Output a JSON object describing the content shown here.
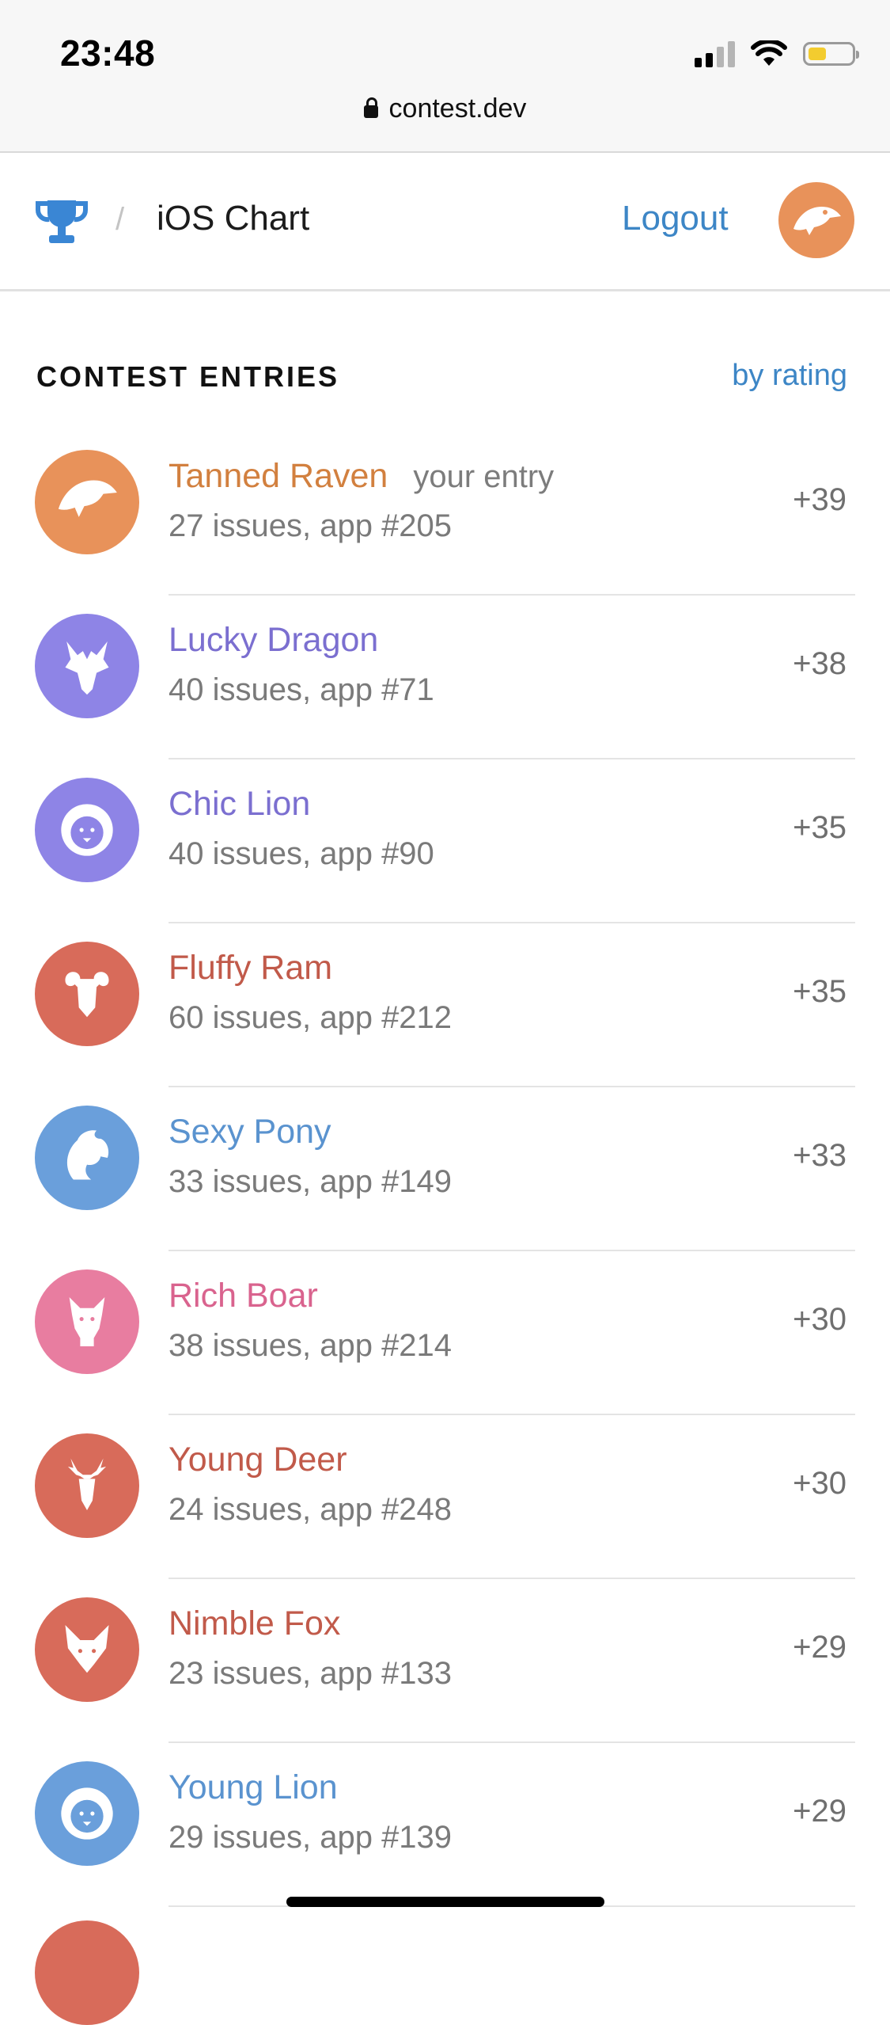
{
  "status_bar": {
    "time": "23:48"
  },
  "browser": {
    "url": "contest.dev"
  },
  "header": {
    "separator": "/",
    "title": "iOS Chart",
    "logout_label": "Logout"
  },
  "section": {
    "title": "CONTEST ENTRIES",
    "sort_label": "by rating"
  },
  "entries": [
    {
      "name": "Tanned Raven",
      "tag": "your entry",
      "meta": "27 issues, app #205",
      "score": "+39",
      "color": "#d2803f",
      "avatar_color": "#e8925a",
      "icon": "raven-icon"
    },
    {
      "name": "Lucky Dragon",
      "tag": "",
      "meta": "40 issues, app #71",
      "score": "+38",
      "color": "#7b6fd0",
      "avatar_color": "#8e84e6",
      "icon": "dragon-icon"
    },
    {
      "name": "Chic Lion",
      "tag": "",
      "meta": "40 issues, app #90",
      "score": "+35",
      "color": "#7b6fd0",
      "avatar_color": "#8e84e6",
      "icon": "lion-icon"
    },
    {
      "name": "Fluffy Ram",
      "tag": "",
      "meta": "60 issues, app #212",
      "score": "+35",
      "color": "#c15a4a",
      "avatar_color": "#d86b5a",
      "icon": "ram-icon"
    },
    {
      "name": "Sexy Pony",
      "tag": "",
      "meta": "33 issues, app #149",
      "score": "+33",
      "color": "#5a93cf",
      "avatar_color": "#6a9fdb",
      "icon": "pony-icon"
    },
    {
      "name": "Rich Boar",
      "tag": "",
      "meta": "38 issues, app #214",
      "score": "+30",
      "color": "#d9638e",
      "avatar_color": "#e87da0",
      "icon": "boar-icon"
    },
    {
      "name": "Young Deer",
      "tag": "",
      "meta": "24 issues, app #248",
      "score": "+30",
      "color": "#c15a4a",
      "avatar_color": "#d86b5a",
      "icon": "deer-icon"
    },
    {
      "name": "Nimble Fox",
      "tag": "",
      "meta": "23 issues, app #133",
      "score": "+29",
      "color": "#c15a4a",
      "avatar_color": "#d86b5a",
      "icon": "fox-icon"
    },
    {
      "name": "Young Lion",
      "tag": "",
      "meta": "29 issues, app #139",
      "score": "+29",
      "color": "#5a93cf",
      "avatar_color": "#6a9fdb",
      "icon": "lion-icon"
    }
  ]
}
